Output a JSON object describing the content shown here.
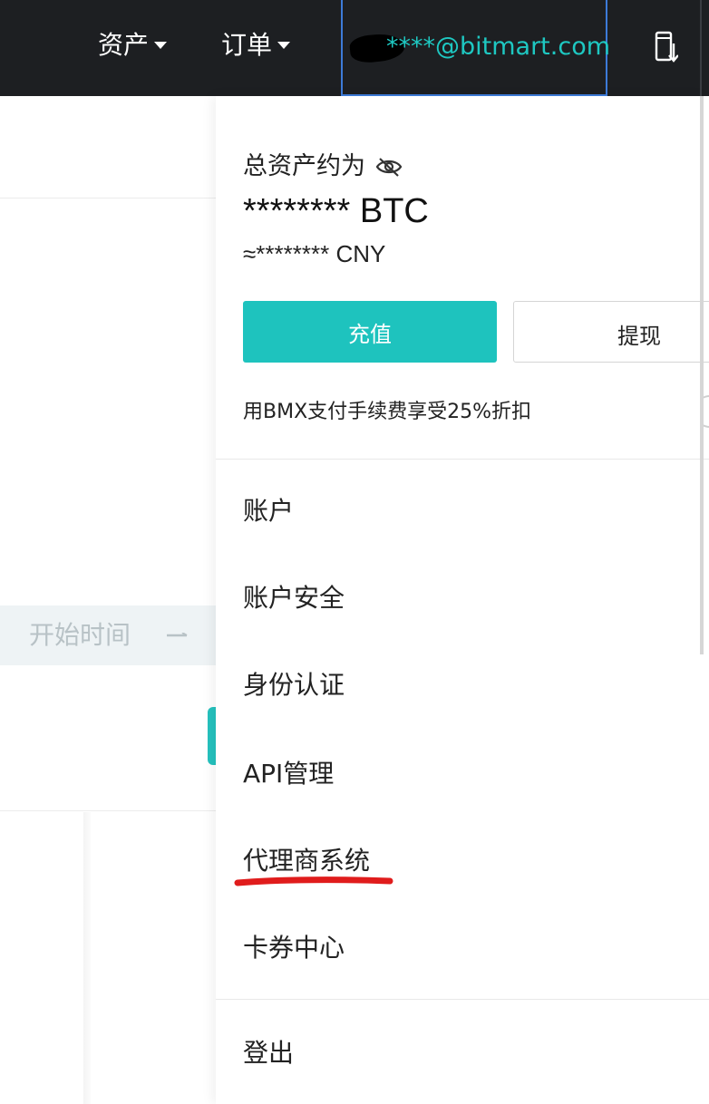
{
  "nav": {
    "assets_label": "资产",
    "orders_label": "订单",
    "account_email": "****@bitmart.com",
    "download_icon": "mobile-download-icon"
  },
  "background_page": {
    "start_time_placeholder": "开始时间",
    "arrow_icon": "arrow-right-icon"
  },
  "dropdown": {
    "asset_title": "总资产约为",
    "visibility_icon": "eye-slash-icon",
    "btc_value": "******** BTC",
    "cny_value": "≈******** CNY",
    "deposit_label": "充值",
    "withdraw_label": "提现",
    "bmx_note": "用BMX支付手续费享受25%折扣",
    "menu_items": [
      {
        "label": "账户"
      },
      {
        "label": "账户安全"
      },
      {
        "label": "身份认证"
      },
      {
        "label": "API管理"
      },
      {
        "label": "代理商系统"
      },
      {
        "label": "卡券中心"
      }
    ],
    "logout_label": "登出"
  },
  "colors": {
    "topbar_bg": "#1d1f22",
    "accent_teal": "#1ec3be",
    "email_text": "#1ec8c2",
    "highlight_border": "#3d7bd9",
    "annotation_red": "#e01c1c"
  }
}
